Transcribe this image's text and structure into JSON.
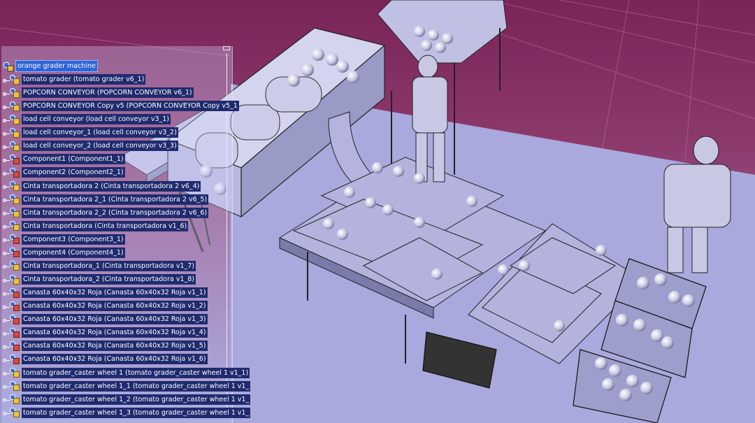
{
  "tree": {
    "root_label": "orange grader machine",
    "items": [
      {
        "label": "tomato grader (tomato grader v6_1)",
        "icon": "product-icon"
      },
      {
        "label": "POPCORN CONVEYOR (POPCORN CONVEYOR v6_1)",
        "icon": "product-icon"
      },
      {
        "label": "POPCORN CONVEYOR Copy v5 (POPCORN CONVEYOR Copy v5_1",
        "icon": "product-icon"
      },
      {
        "label": "load cell conveyor (load cell conveyor v3_1)",
        "icon": "product-icon"
      },
      {
        "label": "load cell conveyor_1 (load cell conveyor v3_2)",
        "icon": "product-icon"
      },
      {
        "label": "load cell conveyor_2 (load cell conveyor v3_3)",
        "icon": "product-icon"
      },
      {
        "label": "Component1 (Component1_1)",
        "icon": "component-icon"
      },
      {
        "label": "Component2 (Component2_1)",
        "icon": "component-icon"
      },
      {
        "label": "Cinta transportadora 2 (Cinta transportadora 2 v6_4)",
        "icon": "product-icon"
      },
      {
        "label": "Cinta transportadora 2_1 (Cinta transportadora 2 v6_5)",
        "icon": "product-icon"
      },
      {
        "label": "Cinta transportadora 2_2 (Cinta transportadora 2 v6_6)",
        "icon": "product-icon"
      },
      {
        "label": "Cinta transportadora (Cinta transportadora v1_6)",
        "icon": "product-icon"
      },
      {
        "label": "Component3 (Component3_1)",
        "icon": "component-icon"
      },
      {
        "label": "Component4 (Component4_1)",
        "icon": "component-icon"
      },
      {
        "label": "Cinta transportadora_1 (Cinta transportadora v1_7)",
        "icon": "product-icon"
      },
      {
        "label": "Cinta transportadora_2 (Cinta transportadora v1_8)",
        "icon": "product-icon"
      },
      {
        "label": "Canasta 60x40x32 Roja (Canasta 60x40x32 Roja v1_1)",
        "icon": "component-icon"
      },
      {
        "label": "Canasta 60x40x32 Roja (Canasta 60x40x32 Roja v1_2)",
        "icon": "component-icon"
      },
      {
        "label": "Canasta 60x40x32 Roja (Canasta 60x40x32 Roja v1_3)",
        "icon": "component-icon"
      },
      {
        "label": "Canasta 60x40x32 Roja (Canasta 60x40x32 Roja v1_4)",
        "icon": "component-icon"
      },
      {
        "label": "Canasta 60x40x32 Roja (Canasta 60x40x32 Roja v1_5)",
        "icon": "component-icon"
      },
      {
        "label": "Canasta 60x40x32 Roja (Canasta 60x40x32 Roja v1_6)",
        "icon": "component-icon"
      },
      {
        "label": "tomato grader_caster wheel 1 (tomato grader_caster wheel 1 v1_1)",
        "icon": "product-icon"
      },
      {
        "label": "tomato grader_caster wheel 1_1 (tomato grader_caster wheel 1 v1_",
        "icon": "product-icon"
      },
      {
        "label": "tomato grader_caster wheel 1_2 (tomato grader_caster wheel 1 v1_",
        "icon": "product-icon"
      },
      {
        "label": "tomato grader_caster wheel 1_3 (tomato grader_caster wheel 1 v1_",
        "icon": "product-icon"
      }
    ]
  },
  "colors": {
    "background_top": "#8a2e62",
    "background_floor": "#9c9dd6",
    "label_bg": "#1f2b6e",
    "label_selected": "#2f64d8"
  }
}
